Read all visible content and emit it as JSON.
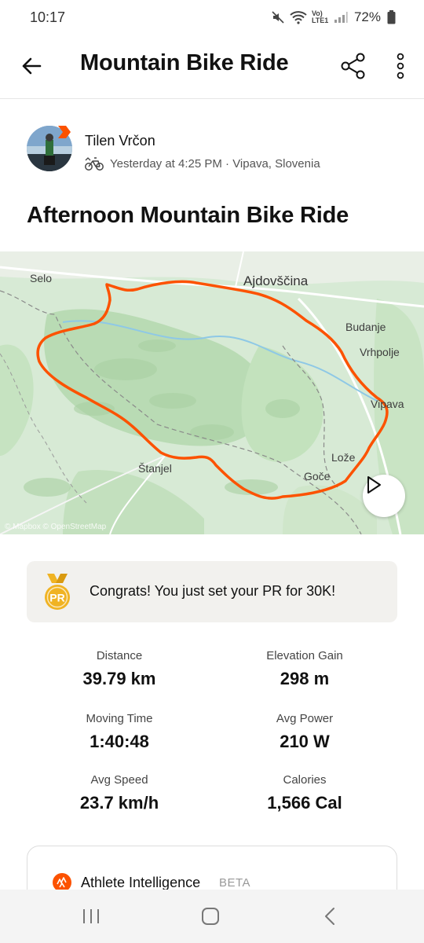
{
  "status_bar": {
    "time": "10:17",
    "battery": "72%",
    "network": "Vo) LTE1"
  },
  "app_bar": {
    "title": "Mountain Bike Ride",
    "icons": [
      "back-arrow-icon",
      "share-icon",
      "more-vertical-icon"
    ]
  },
  "athlete": {
    "name": "Tilen Vrčon",
    "meta": "Yesterday at 4:25 PM · Vipava, Slovenia",
    "sport_icon": "mountain-bike-icon"
  },
  "activity": {
    "title": "Afternoon Mountain Bike Ride"
  },
  "map": {
    "places": {
      "selo": "Selo",
      "ajdovscina": "Ajdovščina",
      "budanje": "Budanje",
      "vrhpolje": "Vrhpolje",
      "vipava": "Vipava",
      "stanjel": "Štanjel",
      "loze": "Lože",
      "goce": "Goče"
    },
    "attribution": "© Mapbox © OpenStreetMap",
    "route_color": "#fc5200"
  },
  "pr_banner": {
    "text": "Congrats! You just set your PR for 30K!",
    "medal_label": "PR",
    "medal_color": "#f0b323"
  },
  "stats": [
    {
      "label": "Distance",
      "value": "39.79 km"
    },
    {
      "label": "Elevation Gain",
      "value": "298 m"
    },
    {
      "label": "Moving Time",
      "value": "1:40:48"
    },
    {
      "label": "Avg Power",
      "value": "210 W"
    },
    {
      "label": "Avg Speed",
      "value": "23.7 km/h"
    },
    {
      "label": "Calories",
      "value": "1,566 Cal"
    }
  ],
  "athlete_intelligence": {
    "title": "Athlete Intelligence",
    "badge": "BETA"
  },
  "nav_bar": {
    "icons": [
      "recents-icon",
      "home-icon",
      "back-icon"
    ]
  }
}
